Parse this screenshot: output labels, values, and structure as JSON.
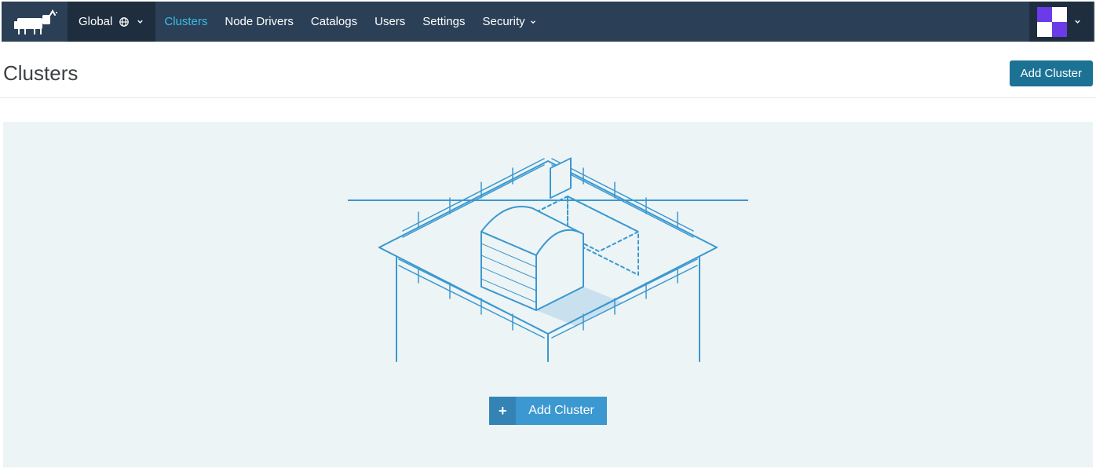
{
  "header": {
    "scope_label": "Global"
  },
  "nav": {
    "items": [
      {
        "label": "Clusters",
        "active": true,
        "dropdown": false
      },
      {
        "label": "Node Drivers",
        "active": false,
        "dropdown": false
      },
      {
        "label": "Catalogs",
        "active": false,
        "dropdown": false
      },
      {
        "label": "Users",
        "active": false,
        "dropdown": false
      },
      {
        "label": "Settings",
        "active": false,
        "dropdown": false
      },
      {
        "label": "Security",
        "active": false,
        "dropdown": true
      }
    ]
  },
  "page": {
    "title": "Clusters",
    "add_button_label": "Add Cluster"
  },
  "empty_state": {
    "add_button_label": "Add Cluster"
  },
  "colors": {
    "topbar_bg": "#2b4056",
    "topbar_dark": "#1e2e3f",
    "accent_nav": "#39bee9",
    "primary_btn_dark": "#1b7295",
    "primary_btn": "#3b98d0",
    "panel_bg": "#edf4f5",
    "avatar_accent": "#6c3be8",
    "illustration_stroke": "#3b98d0"
  }
}
